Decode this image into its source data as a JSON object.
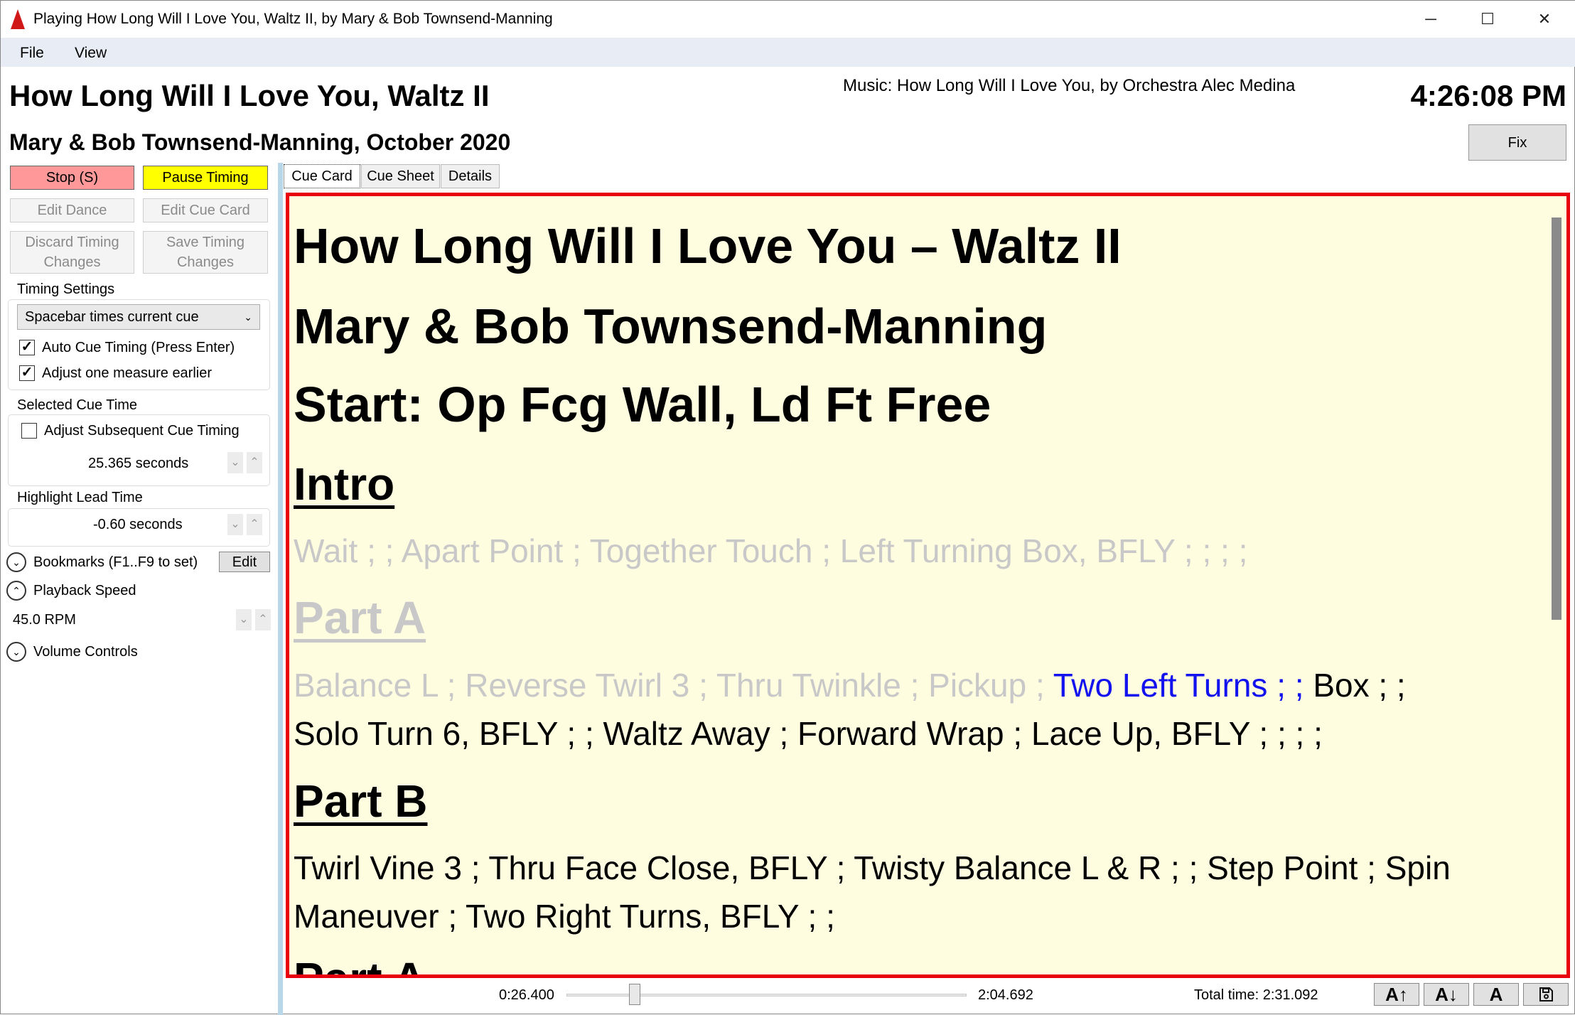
{
  "window": {
    "title": "Playing How Long Will I Love You, Waltz II, by Mary & Bob Townsend-Manning",
    "minimize": "─",
    "maximize": "☐",
    "close": "✕"
  },
  "menu": [
    "File",
    "View"
  ],
  "header": {
    "title": "How Long Will I Love You, Waltz II",
    "subtitle": "Mary & Bob Townsend-Manning, October 2020",
    "music": "Music: How Long Will I Love You, by Orchestra Alec Medina",
    "clock": "4:26:08 PM",
    "fix": "Fix"
  },
  "left": {
    "stop": "Stop (S)",
    "pause": "Pause Timing",
    "edit_dance": "Edit Dance",
    "edit_cue_card": "Edit Cue Card",
    "discard": [
      "Discard Timing",
      "Changes"
    ],
    "save": [
      "Save Timing",
      "Changes"
    ],
    "timing_settings": {
      "label": "Timing Settings",
      "mode": "Spacebar times current cue",
      "auto": "Auto Cue Timing (Press Enter)",
      "auto_checked": true,
      "adjust": "Adjust one measure earlier",
      "adjust_checked": true
    },
    "selected_cue": {
      "label": "Selected Cue Time",
      "adjust": "Adjust Subsequent Cue Timing",
      "adjust_checked": false,
      "value": "25.365 seconds"
    },
    "highlight": {
      "label": "Highlight Lead Time",
      "value": "-0.60 seconds"
    },
    "bookmarks": "Bookmarks (F1..F9 to set)",
    "edit": "Edit",
    "playback": "Playback Speed",
    "rpm": "45.0 RPM",
    "volume": "Volume Controls",
    "colors": {
      "stop": "#ff9999",
      "pause": "#ffff00"
    }
  },
  "tabs": [
    "Cue Card",
    "Cue Sheet",
    "Details"
  ],
  "card": {
    "title": "How Long Will I Love You – Waltz II",
    "dancers": "Mary & Bob Townsend-Manning",
    "start": "Start: Op Fcg Wall, Ld Ft Free",
    "intro": "Intro",
    "intro_line": "Wait ; ; Apart Point ; Together Touch ; Left Turning Box, BFLY ; ; ; ;",
    "partA": "Part A",
    "a1_past": "Balance L ; Reverse Twirl 3 ; Thru Twinkle ; Pickup ; ",
    "a1_cur": "Two Left Turns ; ; ",
    "a1_next": "Box ; ;",
    "a2": "Solo Turn 6, BFLY ; ; Waltz Away ; Forward Wrap ; Lace Up, BFLY ; ; ; ;",
    "partB": "Part B",
    "b1": "Twirl Vine 3 ; Thru Face Close, BFLY ; Twisty Balance L & R ; ; Step Point ; Spin",
    "b2": "Maneuver ; Two Right Turns, BFLY ; ;",
    "partA2": "Part A",
    "colors": {
      "background": "#fffde0",
      "border": "#e8000e",
      "past": "#c8c8c8",
      "current": "#1212ee"
    }
  },
  "bottom": {
    "position": "0:26.400",
    "end": "2:04.692",
    "total": "Total time: 2:31.092",
    "slider_fraction": 0.17,
    "font_up": "A↑",
    "font_down": "A↓",
    "font_reset": "A"
  }
}
